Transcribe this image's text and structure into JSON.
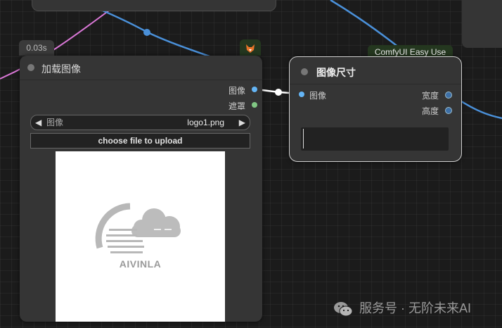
{
  "timing": "0.03s",
  "load_image_node": {
    "title": "加载图像",
    "outputs": [
      {
        "label": "图像",
        "color": "#64b5f6"
      },
      {
        "label": "遮罩",
        "color": "#81c784"
      }
    ],
    "combo": {
      "label": "图像",
      "value": "logo1.png"
    },
    "upload_label": "choose file to upload",
    "preview": {
      "logo_text": "AIVINLA",
      "logo_mark_text": "=="
    }
  },
  "image_size_node": {
    "badge": "ComfyUI Easy Use",
    "title": "图像尺寸",
    "input": {
      "label": "图像",
      "color": "#64b5f6"
    },
    "outputs": [
      {
        "label": "宽度",
        "color": "#3d6fa6"
      },
      {
        "label": "高度",
        "color": "#3d6fa6"
      }
    ]
  },
  "watermark": "服务号 · 无阶未来AI",
  "icons": [
    "fox-icon",
    "wechat-icon",
    "arrow-left-icon",
    "arrow-right-icon"
  ]
}
